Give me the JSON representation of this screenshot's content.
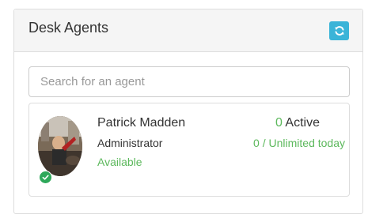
{
  "panel": {
    "title": "Desk Agents",
    "refresh_icon": "refresh-icon"
  },
  "search": {
    "placeholder": "Search for an agent",
    "value": ""
  },
  "agents": [
    {
      "name": "Patrick Madden",
      "role": "Administrator",
      "availability": "Available",
      "active_count": "0",
      "active_label": "Active",
      "today": "0 / Unlimited today",
      "status_icon": "check-circle-icon"
    }
  ],
  "colors": {
    "accent_button": "#3bb4d8",
    "success_green": "#5cb85c",
    "status_dot": "#2ea85a",
    "heading_bg": "#f5f5f5",
    "border": "#dddddd"
  }
}
